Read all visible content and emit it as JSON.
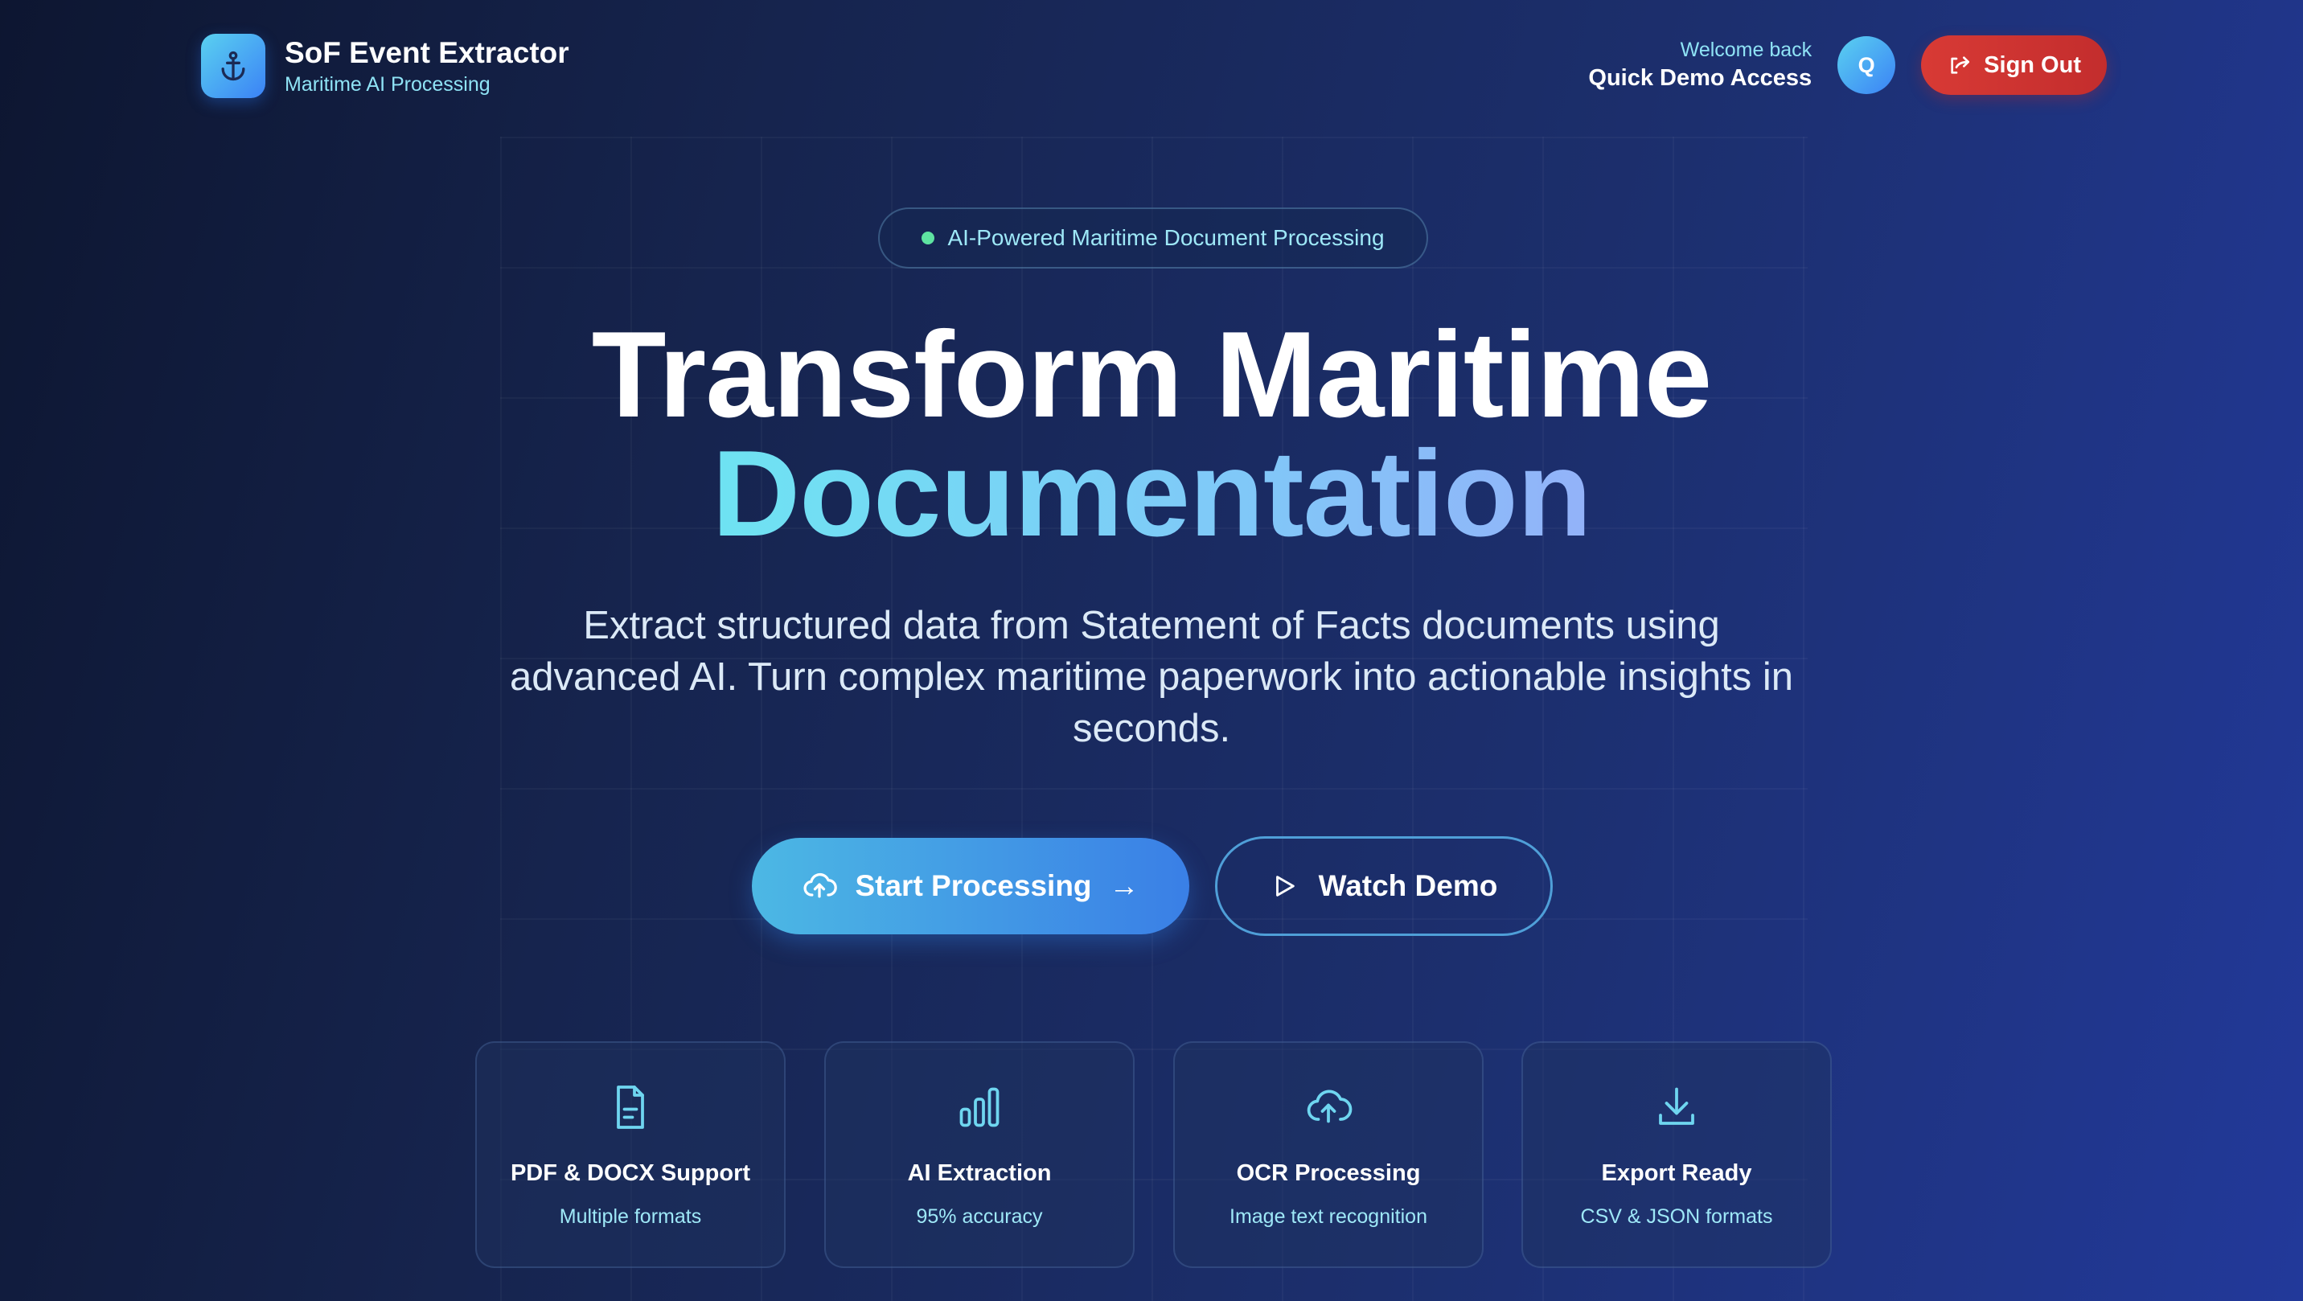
{
  "header": {
    "logo_icon": "anchor-icon",
    "app_title": "SoF Event Extractor",
    "app_subtitle": "Maritime AI Processing",
    "welcome": "Welcome back",
    "username": "Quick Demo Access",
    "avatar_initial": "Q",
    "signout_icon": "sign-out-icon",
    "signout_label": "Sign Out"
  },
  "hero": {
    "badge": "AI-Powered Maritime Document Processing",
    "headline_line1": "Transform Maritime",
    "headline_line2": "Documentation",
    "subtitle": "Extract structured data from Statement of Facts documents using advanced AI. Turn complex maritime paperwork into actionable insights in seconds.",
    "primary_button": {
      "label": "Start Processing",
      "icon": "cloud-upload-icon",
      "trailing": "→"
    },
    "secondary_button": {
      "label": "Watch Demo",
      "icon": "play-icon"
    }
  },
  "features": [
    {
      "icon": "document-icon",
      "title": "PDF & DOCX Support",
      "subtitle": "Multiple formats"
    },
    {
      "icon": "bar-chart-icon",
      "title": "AI Extraction",
      "subtitle": "95% accuracy"
    },
    {
      "icon": "cloud-upload-icon",
      "title": "OCR Processing",
      "subtitle": "Image text recognition"
    },
    {
      "icon": "download-icon",
      "title": "Export Ready",
      "subtitle": "CSV & JSON formats"
    }
  ],
  "colors": {
    "accent_cyan": "#8fe3f5",
    "primary_gradient_start": "#4cb8e4",
    "primary_gradient_end": "#3a7fe6",
    "danger": "#d83a35",
    "status_dot": "#5ee3a1"
  }
}
